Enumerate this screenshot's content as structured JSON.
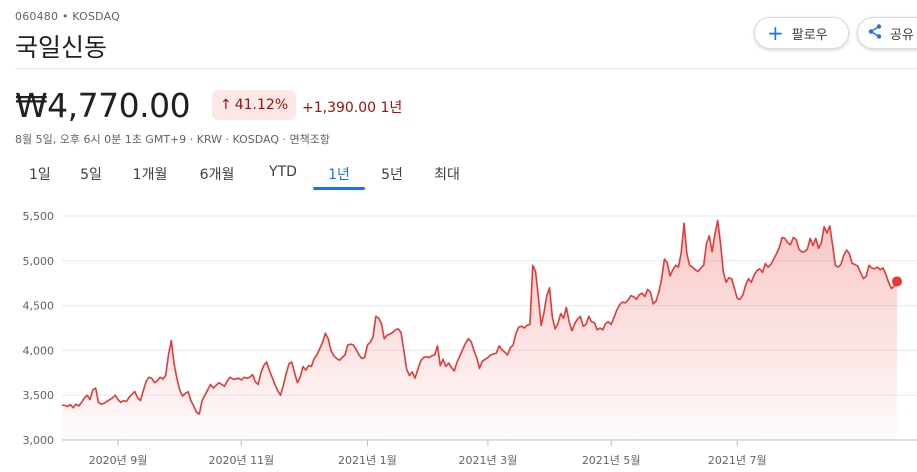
{
  "header": {
    "ticker": "060480 • KOSDAQ",
    "company": "국일신동",
    "follow_label": "팔로우",
    "share_label": "공유"
  },
  "quote": {
    "price": "₩4,770.00",
    "change_percent": "41.12%",
    "change_abs": "+1,390.00 1년",
    "meta": "8월 5일, 오후 6시 0분 1초 GMT+9 · KRW · KOSDAQ · 면책조항"
  },
  "tabs": [
    "1일",
    "5일",
    "1개월",
    "6개월",
    "YTD",
    "1년",
    "5년",
    "최대"
  ],
  "active_tab": "1년",
  "colors": {
    "line": "#e53935",
    "fill": "#fce8e6",
    "accent": "#1a73e8",
    "negative_text": "#a50e0e"
  },
  "chart_data": {
    "type": "area",
    "title": "",
    "xlabel": "",
    "ylabel": "",
    "ylim": [
      3000,
      5500
    ],
    "yticks": [
      3000,
      3500,
      4000,
      4500,
      5000,
      5500
    ],
    "ytick_labels": [
      "3,000",
      "3,500",
      "4,000",
      "4,500",
      "5,000",
      "5,500"
    ],
    "xtick_labels": [
      "2020년 9월",
      "2020년 11월",
      "2021년 1월",
      "2021년 3월",
      "2021년 5월",
      "2021년 7월"
    ],
    "xtick_index": [
      20,
      64,
      109,
      152,
      196,
      241
    ],
    "grid": true,
    "series": [
      {
        "values": [
          3390,
          3385,
          3375,
          3395,
          3360,
          3400,
          3380,
          3420,
          3470,
          3500,
          3450,
          3560,
          3580,
          3420,
          3400,
          3410,
          3430,
          3450,
          3470,
          3500,
          3450,
          3420,
          3440,
          3430,
          3480,
          3510,
          3540,
          3470,
          3440,
          3550,
          3650,
          3700,
          3690,
          3640,
          3660,
          3700,
          3680,
          3720,
          3950,
          4110,
          3850,
          3690,
          3560,
          3490,
          3520,
          3540,
          3440,
          3380,
          3310,
          3290,
          3440,
          3500,
          3560,
          3620,
          3580,
          3610,
          3640,
          3620,
          3600,
          3660,
          3700,
          3680,
          3680,
          3690,
          3670,
          3700,
          3690,
          3700,
          3730,
          3650,
          3620,
          3750,
          3830,
          3870,
          3780,
          3700,
          3620,
          3550,
          3500,
          3610,
          3740,
          3850,
          3870,
          3750,
          3640,
          3700,
          3820,
          3780,
          3830,
          3820,
          3910,
          3950,
          4020,
          4090,
          4190,
          4130,
          4000,
          3940,
          3910,
          3890,
          3920,
          3950,
          4060,
          4070,
          4060,
          4010,
          3950,
          3910,
          3920,
          4060,
          4090,
          4150,
          4380,
          4360,
          4300,
          4130,
          4170,
          4180,
          4200,
          4230,
          4240,
          4200,
          4000,
          3790,
          3720,
          3760,
          3690,
          3790,
          3880,
          3920,
          3930,
          3920,
          3940,
          3950,
          4050,
          3830,
          3900,
          3820,
          3860,
          3810,
          3770,
          3870,
          3940,
          4010,
          4080,
          4130,
          4100,
          4000,
          3920,
          3800,
          3880,
          3900,
          3920,
          3950,
          3960,
          3970,
          4050,
          4010,
          3980,
          3950,
          4030,
          4060,
          4190,
          4260,
          4270,
          4250,
          4280,
          4290,
          4950,
          4880,
          4600,
          4280,
          4420,
          4610,
          4700,
          4370,
          4240,
          4300,
          4410,
          4360,
          4480,
          4320,
          4220,
          4300,
          4350,
          4380,
          4270,
          4290,
          4380,
          4320,
          4310,
          4230,
          4250,
          4230,
          4300,
          4320,
          4290,
          4370,
          4450,
          4510,
          4540,
          4530,
          4560,
          4610,
          4600,
          4570,
          4620,
          4640,
          4600,
          4680,
          4650,
          4520,
          4550,
          4650,
          4800,
          5020,
          4980,
          4830,
          4900,
          4950,
          4930,
          5090,
          5420,
          5080,
          4950,
          4930,
          4900,
          4880,
          4920,
          4950,
          5190,
          5280,
          5100,
          5290,
          5450,
          5200,
          4880,
          4760,
          4810,
          4800,
          4690,
          4580,
          4570,
          4620,
          4730,
          4800,
          4760,
          4840,
          4890,
          4910,
          4870,
          4970,
          4930,
          4960,
          5020,
          5080,
          5150,
          5260,
          5250,
          5200,
          5180,
          5260,
          5240,
          5130,
          5100,
          5100,
          5130,
          5250,
          5170,
          5250,
          5140,
          5200,
          5380,
          5310,
          5390,
          5180,
          4950,
          4930,
          4960,
          5060,
          5120,
          5080,
          4970,
          4960,
          4940,
          4870,
          4800,
          4830,
          4950,
          4920,
          4910,
          4930,
          4900,
          4920,
          4850,
          4760,
          4690,
          4720,
          4770
        ]
      }
    ],
    "last_value": 4770
  }
}
